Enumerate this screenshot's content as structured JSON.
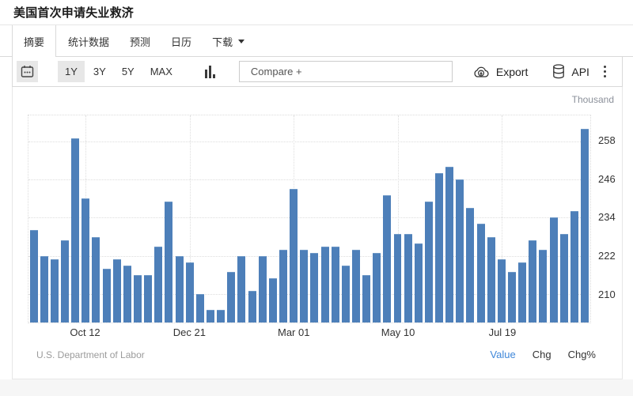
{
  "page": {
    "title": "美国首次申请失业救济",
    "tabs": [
      {
        "label": "摘要",
        "active": true,
        "caret": false
      },
      {
        "label": "统计数据",
        "active": false,
        "caret": false
      },
      {
        "label": "预测",
        "active": false,
        "caret": false
      },
      {
        "label": "日历",
        "active": false,
        "caret": false
      },
      {
        "label": "下载",
        "active": false,
        "caret": true
      }
    ],
    "toolbar": {
      "ranges": [
        "1Y",
        "3Y",
        "5Y",
        "MAX"
      ],
      "active_range": "1Y",
      "compare_placeholder": "Compare +",
      "export_label": "Export",
      "api_label": "API"
    },
    "footer": {
      "source": "U.S. Department of Labor",
      "links": [
        {
          "label": "Value",
          "accent": true
        },
        {
          "label": "Chg",
          "accent": false
        },
        {
          "label": "Chg%",
          "accent": false
        }
      ]
    },
    "colors": {
      "bar": "#4d7fb9",
      "accent_link": "#3f87d9"
    }
  },
  "chart_data": {
    "type": "bar",
    "title": "美国首次申请失业救济 (US Initial Jobless Claims)",
    "unit_label": "Thousand",
    "ylabel": "Thousand",
    "ylim": [
      201,
      266.2
    ],
    "y_ticks": [
      210,
      222,
      234,
      246,
      258
    ],
    "grid": true,
    "x_tick_labels": [
      {
        "index": 5,
        "label": "Oct 12"
      },
      {
        "index": 15,
        "label": "Dec 21"
      },
      {
        "index": 25,
        "label": "Mar 01"
      },
      {
        "index": 35,
        "label": "May 10"
      },
      {
        "index": 45,
        "label": "Jul 19"
      }
    ],
    "values": [
      230,
      222,
      221,
      227,
      259,
      240,
      228,
      218,
      221,
      219,
      216,
      216,
      225,
      239,
      222,
      220,
      210,
      205,
      205,
      217,
      222,
      211,
      222,
      215,
      224,
      243,
      224,
      223,
      225,
      225,
      219,
      224,
      216,
      223,
      241,
      229,
      229,
      226,
      239,
      248,
      250,
      246,
      237,
      232,
      228,
      221,
      217,
      220,
      227,
      224,
      234,
      229,
      236,
      262
    ],
    "source": "U.S. Department of Labor"
  }
}
